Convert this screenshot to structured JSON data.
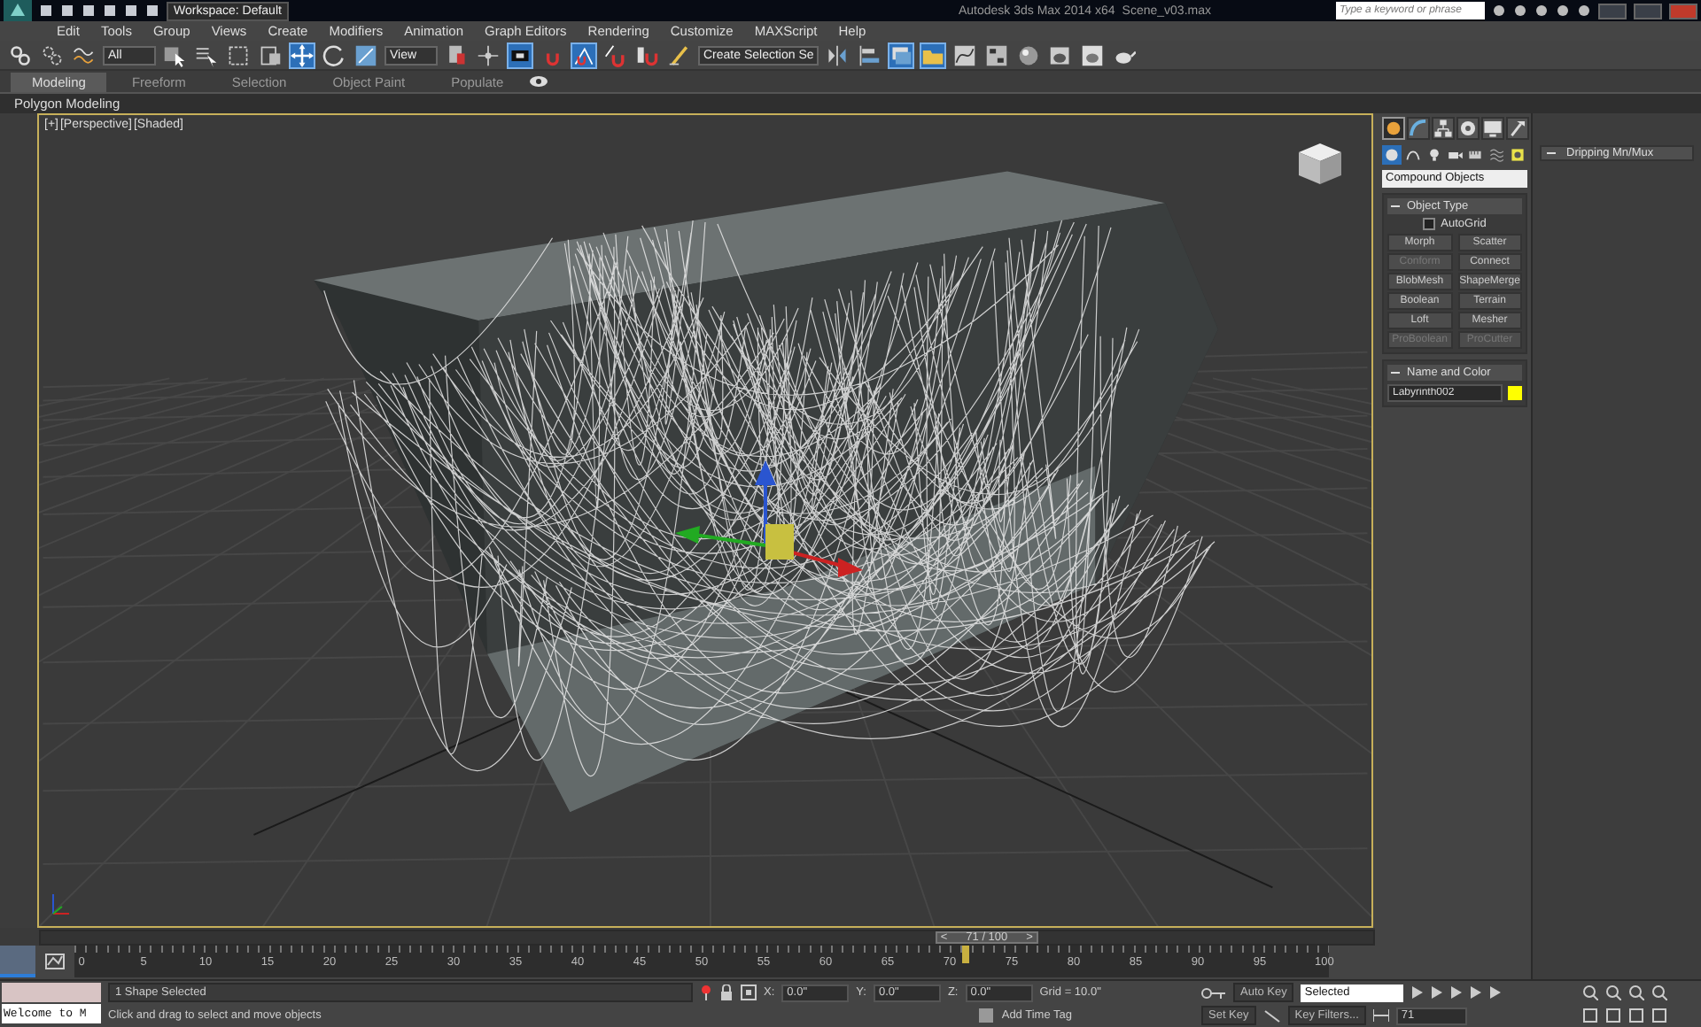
{
  "window": {
    "title": "Autodesk 3ds Max 2014 x64",
    "file": "Scene_v03.max",
    "workspace": "Workspace: Default",
    "search": {
      "placeholder": "Type a keyword or phrase"
    }
  },
  "menu": [
    "Edit",
    "Tools",
    "Group",
    "Views",
    "Create",
    "Modifiers",
    "Animation",
    "Graph Editors",
    "Rendering",
    "Customize",
    "MAXScript",
    "Help"
  ],
  "toolbar": [
    {
      "kind": "link",
      "selected": false
    },
    {
      "kind": "unlink",
      "selected": false
    },
    {
      "kind": "bind",
      "selected": false
    },
    {
      "kind": "dropdown",
      "value": "All"
    },
    {
      "kind": "select",
      "selected": false
    },
    {
      "kind": "select-by-name",
      "selected": false
    },
    {
      "kind": "region",
      "selected": false
    },
    {
      "kind": "crossing",
      "selected": false
    },
    {
      "kind": "move",
      "selected": true
    },
    {
      "kind": "rotate",
      "selected": false
    },
    {
      "kind": "scale",
      "selected": false
    },
    {
      "kind": "dropdown",
      "value": "View"
    },
    {
      "kind": "pivot",
      "selected": false
    },
    {
      "kind": "manipulate",
      "selected": false
    },
    {
      "kind": "shortcut",
      "selected": true
    },
    {
      "kind": "snap",
      "selected": false
    },
    {
      "kind": "angle-snap",
      "selected": true
    },
    {
      "kind": "percent-snap",
      "selected": false
    },
    {
      "kind": "spinner-snap",
      "selected": false
    },
    {
      "kind": "named-sets",
      "selected": false
    },
    {
      "kind": "dropdown",
      "value": "Create Selection Se"
    },
    {
      "kind": "mirror",
      "selected": false
    },
    {
      "kind": "align",
      "selected": false
    },
    {
      "kind": "layers",
      "selected": true
    },
    {
      "kind": "ribbon",
      "selected": true
    },
    {
      "kind": "curve-editor",
      "selected": false
    },
    {
      "kind": "schematic",
      "selected": false
    },
    {
      "kind": "material",
      "selected": false
    },
    {
      "kind": "render-setup",
      "selected": false
    },
    {
      "kind": "frame-window",
      "selected": false
    },
    {
      "kind": "render",
      "selected": false
    }
  ],
  "ribbon": {
    "tabs": [
      {
        "label": "Modeling",
        "selected": true
      },
      {
        "label": "Freeform",
        "selected": false
      },
      {
        "label": "Selection",
        "selected": false
      },
      {
        "label": "Object Paint",
        "selected": false
      },
      {
        "label": "Populate",
        "selected": false
      }
    ],
    "panel": "Polygon Modeling"
  },
  "viewport": {
    "labels": [
      "[+]",
      "[Perspective]",
      "[Shaded]"
    ]
  },
  "command_panel": {
    "tabs": [
      {
        "kind": "create",
        "selected": true
      },
      {
        "kind": "modify",
        "selected": false
      },
      {
        "kind": "hierarchy",
        "selected": false
      },
      {
        "kind": "motion",
        "selected": false
      },
      {
        "kind": "display",
        "selected": false
      },
      {
        "kind": "utilities",
        "selected": false
      }
    ],
    "categories": [
      {
        "kind": "geometry",
        "selected": true
      },
      {
        "kind": "shapes",
        "selected": false
      },
      {
        "kind": "lights",
        "selected": false
      },
      {
        "kind": "cameras",
        "selected": false
      },
      {
        "kind": "helpers",
        "selected": false
      },
      {
        "kind": "spacewarps",
        "selected": false
      },
      {
        "kind": "systems",
        "selected": false
      }
    ],
    "subcategory": "Compound Objects",
    "object_type": {
      "title": "Object Type",
      "expanded": true,
      "autogrid": {
        "label": "AutoGrid",
        "checked": false
      },
      "buttons": [
        {
          "label": "Morph",
          "disabled": false
        },
        {
          "label": "Scatter",
          "disabled": false
        },
        {
          "label": "Conform",
          "disabled": true
        },
        {
          "label": "Connect",
          "disabled": false
        },
        {
          "label": "BlobMesh",
          "disabled": false
        },
        {
          "label": "ShapeMerge",
          "disabled": false
        },
        {
          "label": "Boolean",
          "disabled": false
        },
        {
          "label": "Terrain",
          "disabled": false
        },
        {
          "label": "Loft",
          "disabled": false
        },
        {
          "label": "Mesher",
          "disabled": false
        },
        {
          "label": "ProBoolean",
          "disabled": true
        },
        {
          "label": "ProCutter",
          "disabled": true
        }
      ]
    },
    "name_color": {
      "title": "Name and Color",
      "expanded": true,
      "name": "Labyrinth002",
      "color": "#ffff00"
    }
  },
  "side_panel": {
    "title": "Dripping Mn/Mux",
    "expanded": true
  },
  "time_slider": {
    "label": "71 / 100",
    "prev": "<",
    "next": ">",
    "level": 0.71
  },
  "track_bar": {
    "ticks": [
      "0",
      "5",
      "10",
      "15",
      "20",
      "25",
      "30",
      "35",
      "40",
      "45",
      "50",
      "55",
      "60",
      "65",
      "70",
      "75",
      "80",
      "85",
      "90",
      "95",
      "100"
    ],
    "level": 0.71
  },
  "status": {
    "listener": "Welcome to M",
    "selection": "1 Shape Selected",
    "prompt": "Click and drag to select and move objects",
    "coords": [
      {
        "axis": "X:",
        "value": "0.0\""
      },
      {
        "axis": "Y:",
        "value": "0.0\""
      },
      {
        "axis": "Z:",
        "value": "0.0\""
      }
    ],
    "grid": "Grid = 10.0\"",
    "add_time_tag": "Add Time Tag",
    "auto_key": {
      "label": "Auto Key",
      "on": false
    },
    "key_mode": "Selected",
    "set_key": "Set Key",
    "key_filters": "Key Filters...",
    "frame": "71"
  }
}
